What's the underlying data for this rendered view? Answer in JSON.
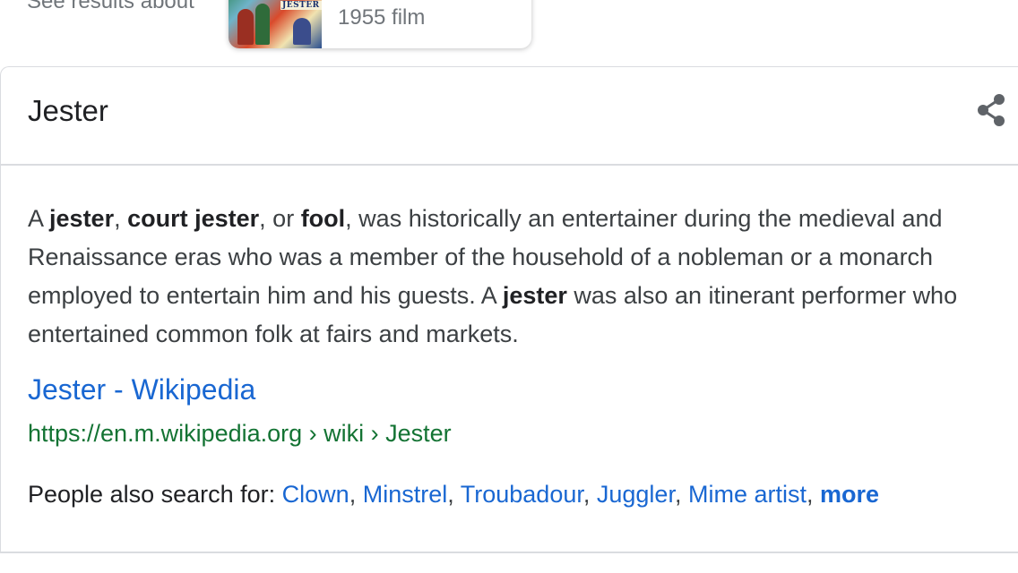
{
  "top": {
    "see_results_label": "See results about",
    "film_card": {
      "thumbnail_text": "JESTER",
      "subtitle": "1955 film"
    }
  },
  "panel": {
    "title": "Jester",
    "share_icon": "share-icon",
    "description": {
      "p1": "A ",
      "b1": "jester",
      "p2": ", ",
      "b2": "court jester",
      "p3": ", or ",
      "b3": "fool",
      "p4": ", was historically an entertainer during the medieval and Renaissance eras who was a member of the household of a nobleman or a monarch employed to entertain him and his guests. A ",
      "b4": "jester",
      "p5": " was also an itinerant performer who entertained common folk at fairs and markets."
    },
    "source": {
      "link_text": "Jester - Wikipedia",
      "url_text": "https://en.m.wikipedia.org › wiki › Jester"
    },
    "people_also_search": {
      "label": "People also search for: ",
      "items": [
        "Clown",
        "Minstrel",
        "Troubadour",
        "Juggler",
        "Mime artist"
      ],
      "more_label": "more"
    }
  },
  "colors": {
    "link": "#1967d2",
    "url_green": "#137333",
    "text": "#3c4043",
    "divider": "#dadce0"
  }
}
